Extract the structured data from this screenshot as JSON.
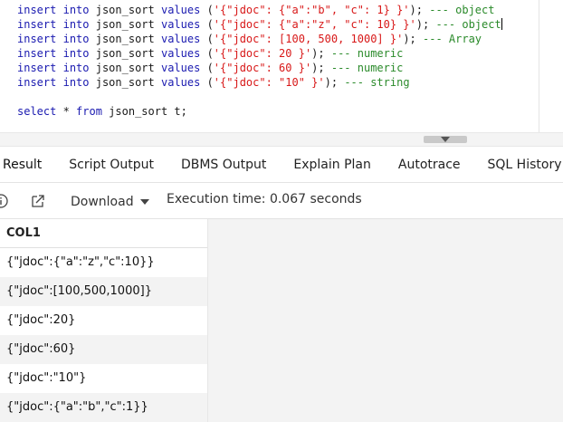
{
  "editor": {
    "lines": [
      [
        {
          "t": "insert",
          "c": "kw"
        },
        {
          "t": " ",
          "c": "pn"
        },
        {
          "t": "into",
          "c": "kw"
        },
        {
          "t": " json_sort ",
          "c": "id"
        },
        {
          "t": "values",
          "c": "kw"
        },
        {
          "t": " (",
          "c": "pn"
        },
        {
          "t": "'{\"jdoc\": {\"a\":\"b\", \"c\": 1} }'",
          "c": "str"
        },
        {
          "t": "); ",
          "c": "pn"
        },
        {
          "t": "--- object",
          "c": "cm"
        }
      ],
      [
        {
          "t": "insert",
          "c": "kw"
        },
        {
          "t": " ",
          "c": "pn"
        },
        {
          "t": "into",
          "c": "kw"
        },
        {
          "t": " json_sort ",
          "c": "id"
        },
        {
          "t": "values",
          "c": "kw"
        },
        {
          "t": " (",
          "c": "pn"
        },
        {
          "t": "'{\"jdoc\": {\"a\":\"z\", \"c\": 10} }'",
          "c": "str"
        },
        {
          "t": "); ",
          "c": "pn"
        },
        {
          "t": "--- object",
          "c": "cm"
        }
      ],
      [
        {
          "t": "insert",
          "c": "kw"
        },
        {
          "t": " ",
          "c": "pn"
        },
        {
          "t": "into",
          "c": "kw"
        },
        {
          "t": " json_sort ",
          "c": "id"
        },
        {
          "t": "values",
          "c": "kw"
        },
        {
          "t": " (",
          "c": "pn"
        },
        {
          "t": "'{\"jdoc\": [100, 500, 1000] }'",
          "c": "str"
        },
        {
          "t": "); ",
          "c": "pn"
        },
        {
          "t": "--- Array",
          "c": "cm"
        }
      ],
      [
        {
          "t": "insert",
          "c": "kw"
        },
        {
          "t": " ",
          "c": "pn"
        },
        {
          "t": "into",
          "c": "kw"
        },
        {
          "t": " json_sort ",
          "c": "id"
        },
        {
          "t": "values",
          "c": "kw"
        },
        {
          "t": " (",
          "c": "pn"
        },
        {
          "t": "'{\"jdoc\": 20 }'",
          "c": "str"
        },
        {
          "t": "); ",
          "c": "pn"
        },
        {
          "t": "--- numeric",
          "c": "cm"
        }
      ],
      [
        {
          "t": "insert",
          "c": "kw"
        },
        {
          "t": " ",
          "c": "pn"
        },
        {
          "t": "into",
          "c": "kw"
        },
        {
          "t": " json_sort ",
          "c": "id"
        },
        {
          "t": "values",
          "c": "kw"
        },
        {
          "t": " (",
          "c": "pn"
        },
        {
          "t": "'{\"jdoc\": 60 }'",
          "c": "str"
        },
        {
          "t": "); ",
          "c": "pn"
        },
        {
          "t": "--- numeric",
          "c": "cm"
        }
      ],
      [
        {
          "t": "insert",
          "c": "kw"
        },
        {
          "t": " ",
          "c": "pn"
        },
        {
          "t": "into",
          "c": "kw"
        },
        {
          "t": " json_sort ",
          "c": "id"
        },
        {
          "t": "values",
          "c": "kw"
        },
        {
          "t": " (",
          "c": "pn"
        },
        {
          "t": "'{\"jdoc\": \"10\" }'",
          "c": "str"
        },
        {
          "t": "); ",
          "c": "pn"
        },
        {
          "t": "--- string",
          "c": "cm"
        }
      ],
      [],
      [
        {
          "t": "select",
          "c": "kw"
        },
        {
          "t": " * ",
          "c": "pn"
        },
        {
          "t": "from",
          "c": "kw"
        },
        {
          "t": " json_sort t;",
          "c": "id"
        }
      ]
    ],
    "cursor_line": 1
  },
  "tabs": [
    {
      "label": "Result",
      "active": true
    },
    {
      "label": "Script Output",
      "active": false
    },
    {
      "label": "DBMS Output",
      "active": false
    },
    {
      "label": "Explain Plan",
      "active": false
    },
    {
      "label": "Autotrace",
      "active": false
    },
    {
      "label": "SQL History",
      "active": false
    }
  ],
  "toolbar": {
    "info_icon": "info-icon",
    "export_icon": "open-in-new-icon",
    "download_label": "Download",
    "execution_time": "Execution time: 0.067 seconds"
  },
  "grid": {
    "columns": [
      "COL1"
    ],
    "rows": [
      "{\"jdoc\":{\"a\":\"z\",\"c\":10}}",
      "{\"jdoc\":[100,500,1000]}",
      "{\"jdoc\":20}",
      "{\"jdoc\":60}",
      "{\"jdoc\":\"10\"}",
      "{\"jdoc\":{\"a\":\"b\",\"c\":1}}"
    ]
  },
  "colors": {
    "keyword": "#1a1ab0",
    "string": "#d81818",
    "comment": "#2a8a2a"
  }
}
